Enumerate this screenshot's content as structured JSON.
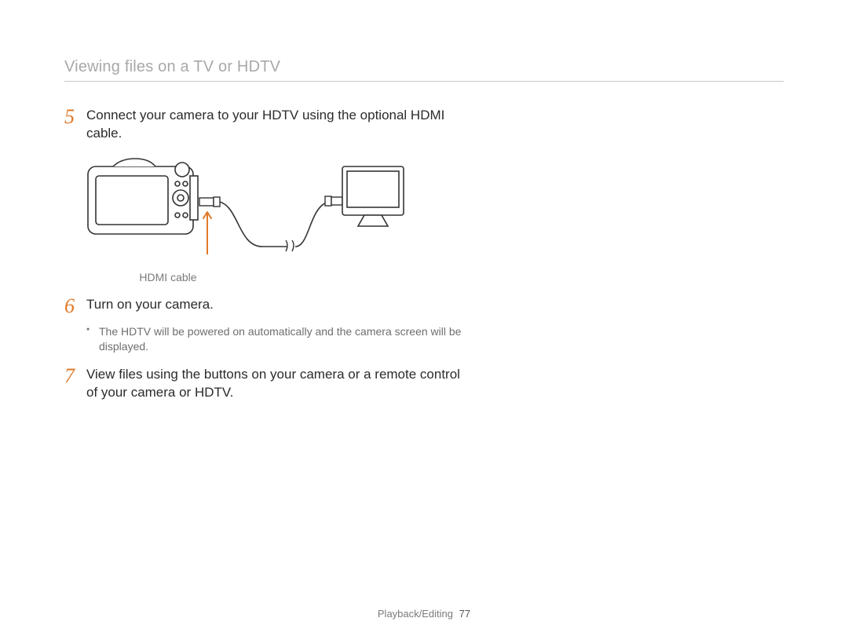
{
  "header": {
    "title": "Viewing files on a TV or HDTV"
  },
  "steps": {
    "s5": {
      "num": "5",
      "text": "Connect your camera to your HDTV using the optional HDMI cable."
    },
    "s6": {
      "num": "6",
      "text": "Turn on your camera.",
      "bullet1": "The HDTV will be powered on automatically and the camera screen will be displayed."
    },
    "s7": {
      "num": "7",
      "text": "View files using the buttons on your camera or a remote control of your camera or HDTV."
    }
  },
  "diagram": {
    "caption": "HDMI cable",
    "accent": "#e07a2a"
  },
  "footer": {
    "section": "Playback/Editing",
    "page": "77"
  }
}
